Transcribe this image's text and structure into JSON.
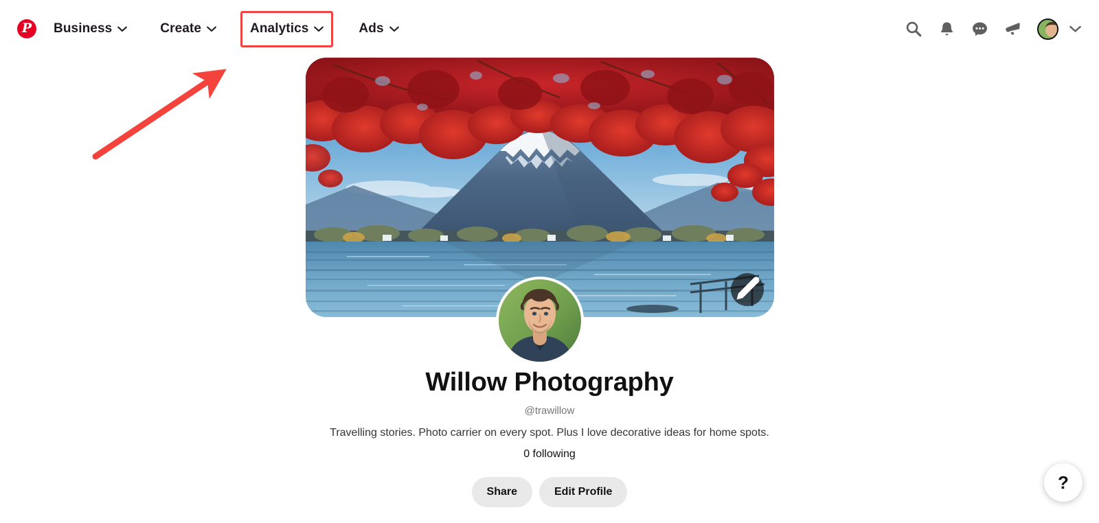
{
  "header": {
    "logo": {
      "name": "pinterest-logo",
      "glyph": "P",
      "color": "#e60023"
    },
    "nav_items": [
      {
        "label": "Business",
        "icon": "chevron-down-icon",
        "highlighted": false
      },
      {
        "label": "Create",
        "icon": "chevron-down-icon",
        "highlighted": false
      },
      {
        "label": "Analytics",
        "icon": "chevron-down-icon",
        "highlighted": true
      },
      {
        "label": "Ads",
        "icon": "chevron-down-icon",
        "highlighted": false
      }
    ],
    "right_icons": [
      {
        "name": "search-icon"
      },
      {
        "name": "bell-icon"
      },
      {
        "name": "message-bubble-icon"
      },
      {
        "name": "megaphone-icon"
      },
      {
        "name": "avatar"
      },
      {
        "name": "chevron-down-icon"
      }
    ]
  },
  "annotation": {
    "arrow_color": "#f4423c",
    "points_to": "Analytics"
  },
  "cover": {
    "alt": "Mount Fuji across a lake framed by red maple leaves",
    "edit_button_label": "Edit cover",
    "edit_icon": "pencil-icon"
  },
  "profile": {
    "avatar_alt": "Profile photo of man with curly hair",
    "display_name": "Willow Photography",
    "username": "@trawillow",
    "bio": "Travelling stories. Photo carrier on every spot. Plus I love decorative ideas for home spots.",
    "following": "0 following",
    "actions": [
      {
        "label": "Share"
      },
      {
        "label": "Edit Profile"
      }
    ]
  },
  "help": {
    "label": "?",
    "name": "help-button"
  }
}
